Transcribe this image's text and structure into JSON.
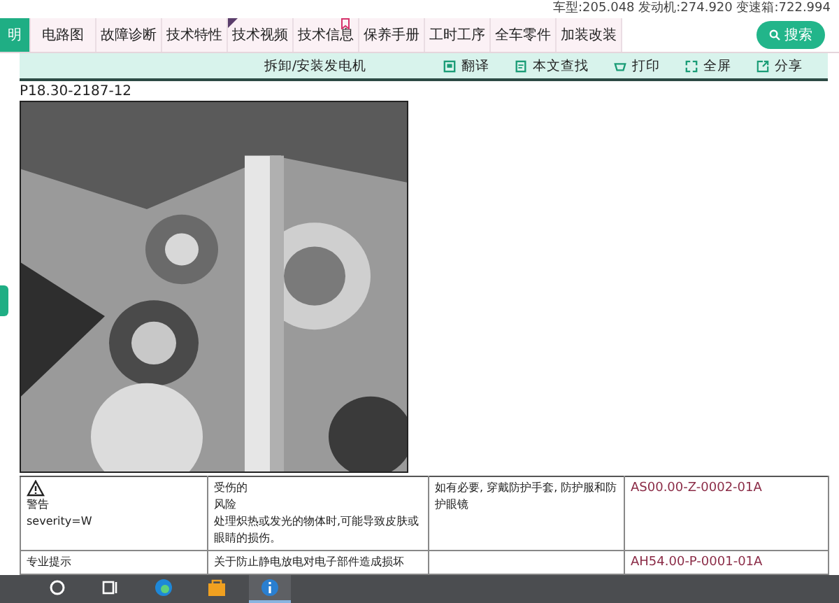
{
  "header": {
    "vehicle_info": "车型:205.048 发动机:274.920 变速箱:722.994"
  },
  "tabs": [
    {
      "label": "明",
      "selected": true,
      "kind": "plain"
    },
    {
      "label": "电路图",
      "selected": false,
      "kind": "plain"
    },
    {
      "label": "故障诊断",
      "selected": false,
      "kind": "plain"
    },
    {
      "label": "技术特性",
      "selected": false,
      "kind": "plain"
    },
    {
      "label": "技术视频",
      "selected": false,
      "kind": "corner"
    },
    {
      "label": "技术信息",
      "selected": false,
      "kind": "bookmark"
    },
    {
      "label": "保养手册",
      "selected": false,
      "kind": "plain"
    },
    {
      "label": "工时工序",
      "selected": false,
      "kind": "plain"
    },
    {
      "label": "全车零件",
      "selected": false,
      "kind": "plain"
    },
    {
      "label": "加装改装",
      "selected": false,
      "kind": "plain"
    }
  ],
  "search_button": "搜索",
  "toolbar": {
    "title": "拆卸/安装发电机",
    "actions": [
      {
        "label": "翻译",
        "kind": "translate"
      },
      {
        "label": "本文查找",
        "kind": "find"
      },
      {
        "label": "打印",
        "kind": "print"
      },
      {
        "label": "全屏",
        "kind": "fullscreen"
      },
      {
        "label": "分享",
        "kind": "share"
      }
    ]
  },
  "document": {
    "figure_code": "P18.30-2187-12",
    "table": {
      "rows": [
        {
          "cells": [
            {
              "lines": [
                "警告",
                "severity=W"
              ],
              "kind": "warning"
            },
            {
              "lines": [
                "受伤的",
                "风险",
                "处理炽热或发光的物体时,可能导致皮肤或眼睛的损伤。"
              ]
            },
            {
              "lines": [
                "如有必要, 穿戴防护手套, 防护服和防护眼镜"
              ]
            },
            {
              "lines": [
                "AS00.00-Z-0002-01A"
              ],
              "kind": "link"
            }
          ]
        },
        {
          "cells": [
            {
              "lines": [
                "专业提示"
              ]
            },
            {
              "lines": [
                "关于防止静电放电对电子部件造成损坏"
              ]
            },
            {
              "kind": "empty"
            },
            {
              "lines": [
                "AH54.00-P-0001-01A"
              ],
              "kind": "link"
            }
          ]
        }
      ]
    }
  },
  "taskbar": {
    "apps": [
      {
        "kind": "search"
      },
      {
        "kind": "taskview"
      },
      {
        "kind": "browser"
      },
      {
        "kind": "store"
      },
      {
        "kind": "info",
        "selected": true
      }
    ]
  }
}
